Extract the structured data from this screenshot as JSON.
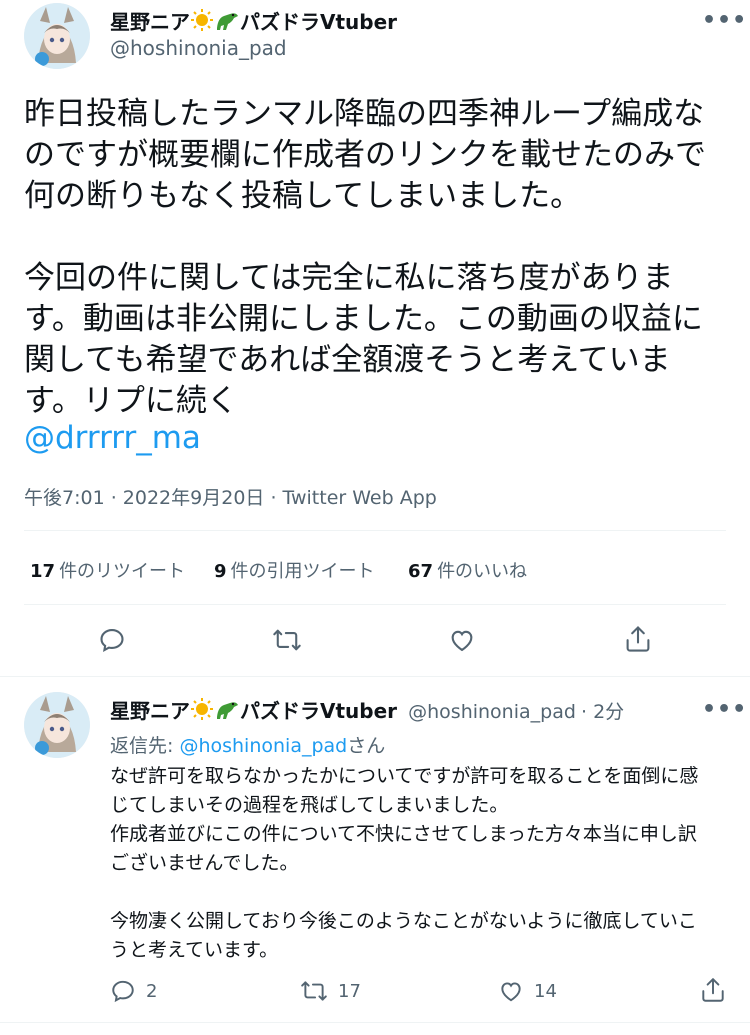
{
  "tweet": {
    "display_name": "星野ニア",
    "name_suffix": "パズドラVtuber",
    "handle": "@hoshinonia_pad",
    "more": "•••",
    "text": "昨日投稿したランマル降臨の四季神ループ編成な\nのですが概要欄に作成者のリンクを載せたのみで\n何の断りもなく投稿してしまいました。\n\n今回の件に関しては完全に私に落ち度がありま\nす。動画は非公開にしました。この動画の収益に\n関しても希望であれば全額渡そうと考えていま\nす。リプに続く",
    "mention": "@drrrrr_ma",
    "timestamp": "午後7:01 · 2022年9月20日 · Twitter Web App",
    "stats": {
      "retweets_count": "17",
      "retweets_label": "件のリツイート",
      "quotes_count": "9",
      "quotes_label": "件の引用ツイート",
      "likes_count": "67",
      "likes_label": "件のいいね"
    }
  },
  "reply": {
    "display_name": "星野ニア",
    "name_suffix": "パズドラVtuber",
    "handle": "@hoshinonia_pad",
    "time": "· 2分",
    "more": "•••",
    "replying_prefix": "返信先: ",
    "replying_to": "@hoshinonia_pad",
    "replying_suffix": "さん",
    "text": "なぜ許可を取らなかったかについてですが許可を取ることを面倒に感\nじてしまいその過程を飛ばしてしまいました。\n作成者並びにこの件について不快にさせてしまった方々本当に申し訳\nございませんでした。\n\n今物凄く公開しており今後このようなことがないように徹底していこ\nうと考えています。",
    "reply_count": "2",
    "retweet_count": "17",
    "like_count": "14"
  },
  "colors": {
    "link": "#1d9bf0",
    "secondary": "#536471",
    "divider": "#eff3f4"
  },
  "icons": [
    "sun-emoji-icon",
    "crocodile-emoji-icon",
    "reply-icon",
    "retweet-icon",
    "like-icon",
    "share-icon"
  ]
}
